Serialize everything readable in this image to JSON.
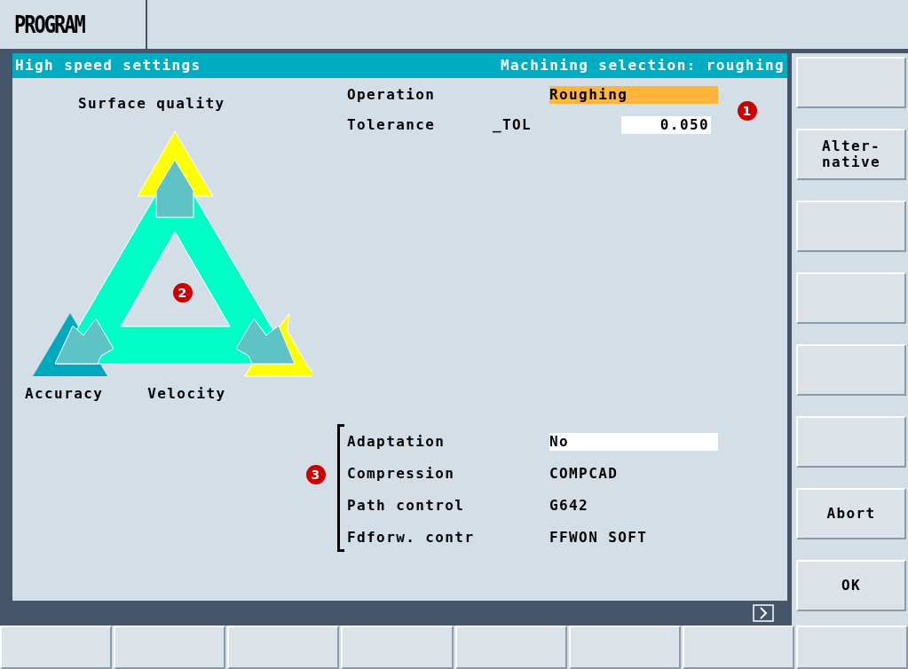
{
  "top_bar": {
    "title": "PROGRAM"
  },
  "header": {
    "title": "High speed settings",
    "selection": "Machining selection: roughing"
  },
  "diagram": {
    "top_label": "Surface quality",
    "left_label": "Accuracy",
    "right_label": "Velocity",
    "marker": "2"
  },
  "top_fields": [
    {
      "label": "Operation",
      "kind": "toggle",
      "value": "Roughing",
      "focused": true
    },
    {
      "label": "Tolerance",
      "param": "_TOL",
      "kind": "input",
      "value": "0.050",
      "focused": false
    }
  ],
  "top_marker": "1",
  "group_marker": "3",
  "group_fields": [
    {
      "label": "Adaptation",
      "kind": "toggle",
      "value": "No",
      "focused": false
    },
    {
      "label": "Compression",
      "kind": "display",
      "value": "COMPCAD",
      "focused": false
    },
    {
      "label": "Path control",
      "kind": "display",
      "value": "G642",
      "focused": false
    },
    {
      "label": "Fdforw. contr",
      "kind": "display",
      "value": "FFWON SOFT",
      "focused": false
    }
  ],
  "right_softkeys": [
    {
      "kind": "blank"
    },
    {
      "kind": "labeled",
      "label": "Alter-\nnative"
    },
    {
      "kind": "blank"
    },
    {
      "kind": "blank"
    },
    {
      "kind": "blank"
    },
    {
      "kind": "blank"
    },
    {
      "kind": "labeled",
      "label": "Abort"
    },
    {
      "kind": "labeled",
      "label": "OK"
    }
  ],
  "bottom_softkeys": [
    {
      "kind": "blank"
    },
    {
      "kind": "blank"
    },
    {
      "kind": "blank"
    },
    {
      "kind": "blank"
    },
    {
      "kind": "blank"
    },
    {
      "kind": "blank"
    },
    {
      "kind": "blank"
    },
    {
      "kind": "blank"
    }
  ]
}
